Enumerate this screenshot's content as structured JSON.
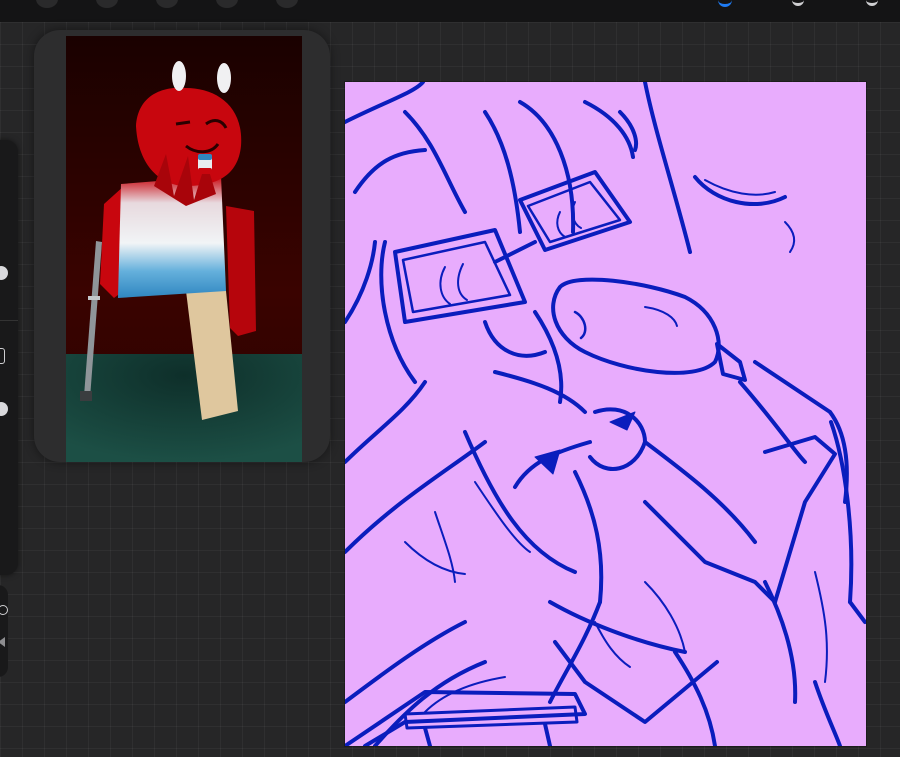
{
  "app": {
    "background_color": "#262627",
    "accent_color": "#1f7bf2"
  },
  "toolbar": {
    "icons": [
      "actions-icon",
      "adjustments-icon",
      "selection-icon",
      "transform-icon",
      "brush-icon",
      "smudge-icon",
      "eraser-icon"
    ],
    "active_tool_color": "#1f7bf2"
  },
  "sidebar": {
    "icons": [
      "brush-size-slider-icon",
      "modify-button-icon",
      "opacity-slider-icon",
      "undo-icon",
      "redo-icon"
    ]
  },
  "reference": {
    "description_icon": "reference-image-icon",
    "colors": {
      "background": "#2b0200",
      "floor": "#113b34",
      "character_red": "#c8060e",
      "stripe_white": "#e8ecef",
      "stripe_blue": "#3c93c6",
      "leg_skin": "#dfc79e",
      "crutch": "#8f9599"
    }
  },
  "canvas": {
    "fill_color": "#e8acfd",
    "line_color": "#0a1dbd"
  }
}
